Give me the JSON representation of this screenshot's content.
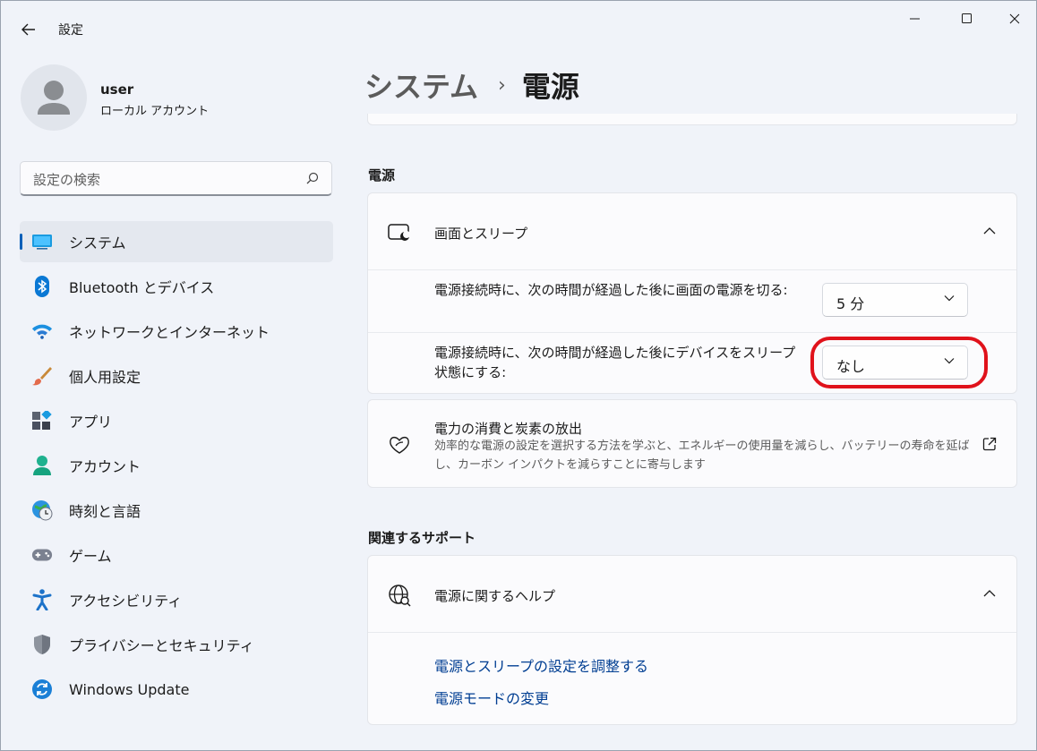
{
  "window": {
    "title": "設定",
    "controls": [
      "minimize-icon",
      "maximize-icon",
      "close-icon"
    ]
  },
  "user": {
    "name": "user",
    "account_type": "ローカル アカウント"
  },
  "search": {
    "placeholder": "設定の検索"
  },
  "sidebar": {
    "items": [
      {
        "label": "システム",
        "icon": "system-display-icon",
        "selected": true
      },
      {
        "label": "Bluetooth とデバイス",
        "icon": "bluetooth-icon"
      },
      {
        "label": "ネットワークとインターネット",
        "icon": "wifi-icon"
      },
      {
        "label": "個人用設定",
        "icon": "paintbrush-icon"
      },
      {
        "label": "アプリ",
        "icon": "apps-icon"
      },
      {
        "label": "アカウント",
        "icon": "account-icon"
      },
      {
        "label": "時刻と言語",
        "icon": "time-language-icon"
      },
      {
        "label": "ゲーム",
        "icon": "gamepad-icon"
      },
      {
        "label": "アクセシビリティ",
        "icon": "accessibility-icon"
      },
      {
        "label": "プライバシーとセキュリティ",
        "icon": "shield-icon"
      },
      {
        "label": "Windows Update",
        "icon": "windows-update-icon"
      }
    ]
  },
  "breadcrumb": {
    "parent": "システム",
    "separator": "›",
    "current": "電源"
  },
  "power_section": {
    "title": "電源",
    "screen_sleep": {
      "title": "画面とスリープ",
      "screen_off_label": "電源接続時に、次の時間が経過した後に画面の電源を切る:",
      "screen_off_value": "5 分",
      "sleep_label": "電源接続時に、次の時間が経過した後にデバイスをスリープ状態にする:",
      "sleep_value": "なし"
    },
    "energy": {
      "title": "電力の消費と炭素の放出",
      "description": "効率的な電源の設定を選択する方法を学ぶと、エネルギーの使用量を減らし、バッテリーの寿命を延ばし、カーボン インパクトを減らすことに寄与します"
    }
  },
  "support_section": {
    "title": "関連するサポート",
    "help": {
      "title": "電源に関するヘルプ",
      "links": [
        "電源とスリープの設定を調整する",
        "電源モードの変更"
      ]
    }
  },
  "colors": {
    "accent": "#005fb8",
    "highlight_ring": "#e0121b",
    "link": "#003e92"
  }
}
